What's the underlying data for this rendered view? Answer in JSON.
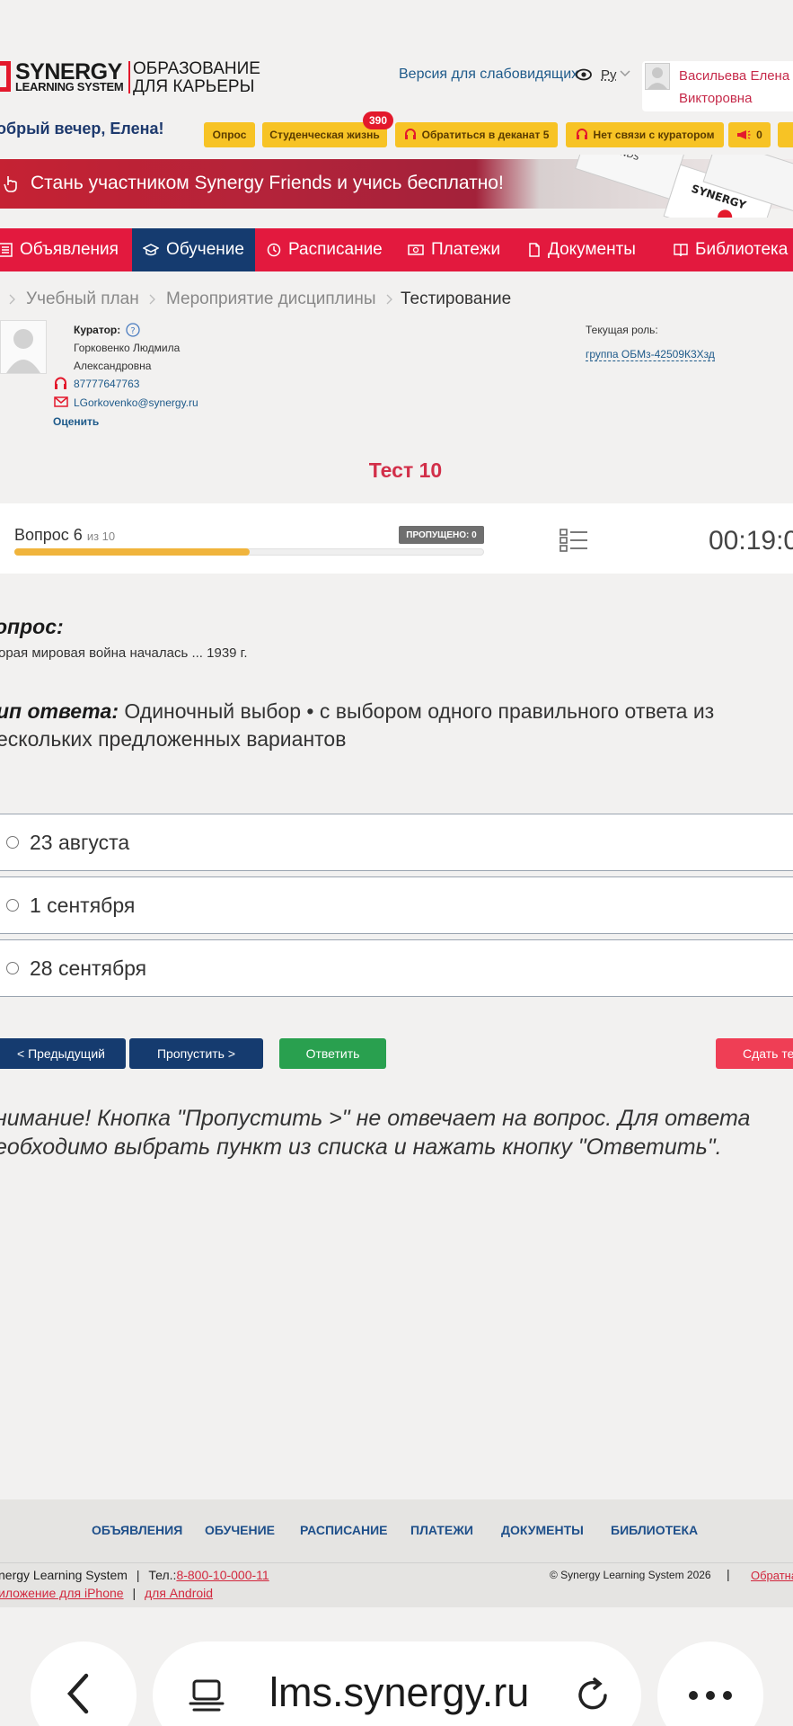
{
  "header": {
    "logo_main": "SYNERGY",
    "logo_sub": "LEARNING SYSTEM",
    "logo_edu_line1": "ОБРАЗОВАНИЕ",
    "logo_edu_line2": "ДЛЯ КАРЬЕРЫ",
    "accessibility_link": "Версия для слабовидящих",
    "language": "Ру",
    "user_name_line1": "Васильева Елена",
    "user_name_line2": "Викторовна",
    "greeting": "обрый вечер, Елена!"
  },
  "quick_buttons": [
    {
      "label": "Опрос"
    },
    {
      "label": "Студенческая жизнь",
      "badge": "390"
    },
    {
      "label": "Обратиться в деканат 5"
    },
    {
      "label": "Нет связи с куратором"
    },
    {
      "label": "0"
    }
  ],
  "banner": {
    "text": "Стань участником Synergy Friends и учись бесплатно!"
  },
  "nav": {
    "items": [
      {
        "label": "Объявления"
      },
      {
        "label": "Обучение",
        "active": true
      },
      {
        "label": "Расписание"
      },
      {
        "label": "Платежи"
      },
      {
        "label": "Документы"
      },
      {
        "label": "Библиотека"
      }
    ]
  },
  "breadcrumb": [
    "Учебный план",
    "Мероприятие дисциплины",
    "Тестирование"
  ],
  "curator": {
    "label": "Куратор:",
    "name_line1": "Горковенко Людмила",
    "name_line2": "Александровна",
    "phone": "87777647763",
    "email": "LGorkovenko@synergy.ru",
    "rate_link": "Оценить",
    "role_label": "Текущая роль:",
    "role_value": "группа ОБМз-42509К3Хзд"
  },
  "test": {
    "title": "Тест 10",
    "question_label": "Вопрос 6",
    "question_of": "из 10",
    "question_progress_fraction": 0.5,
    "skipped": "ПРОПУЩЕНО: 0",
    "timer": "00:19:0"
  },
  "question": {
    "heading": "опрос:",
    "text": "орая мировая война началась ... 1939 г.",
    "type_label": "ип ответа:",
    "type_text": "Одиночный выбор • с выбором одного правильного ответа из ескольких предложенных вариантов"
  },
  "options": [
    "23 августа",
    "1 сентября",
    "28 сентября"
  ],
  "buttons": {
    "prev": "< Предыдущий",
    "skip": "Пропустить >",
    "answer": "Ответить",
    "submit": "Сдать тес"
  },
  "warning": "нимание! Кнопка \"Пропустить >\" не отвечает на вопрос. Для ответа еобходимо выбрать пункт из списка и нажать кнопку \"Ответить\".",
  "footer": {
    "links": [
      "ОБЪЯВЛЕНИЯ",
      "ОБУЧЕНИЕ",
      "РАСПИСАНИЕ",
      "ПЛАТЕЖИ",
      "ДОКУМЕНТЫ",
      "БИБЛИОТЕКА"
    ],
    "system_name": "nergy Learning System",
    "phone_label": "Тел.:",
    "phone": "8-800-10-000-11",
    "iphone_app": "иложение для iPhone",
    "android_app": "для Android",
    "copyright": "© Synergy Learning System 2026",
    "feedback": "Обратна"
  },
  "browser": {
    "url": "lms.synergy.ru"
  },
  "colors": {
    "brand_red": "#e3193e",
    "nav_active": "#153b6f",
    "yellow": "#f7c325",
    "green": "#29a04f"
  }
}
